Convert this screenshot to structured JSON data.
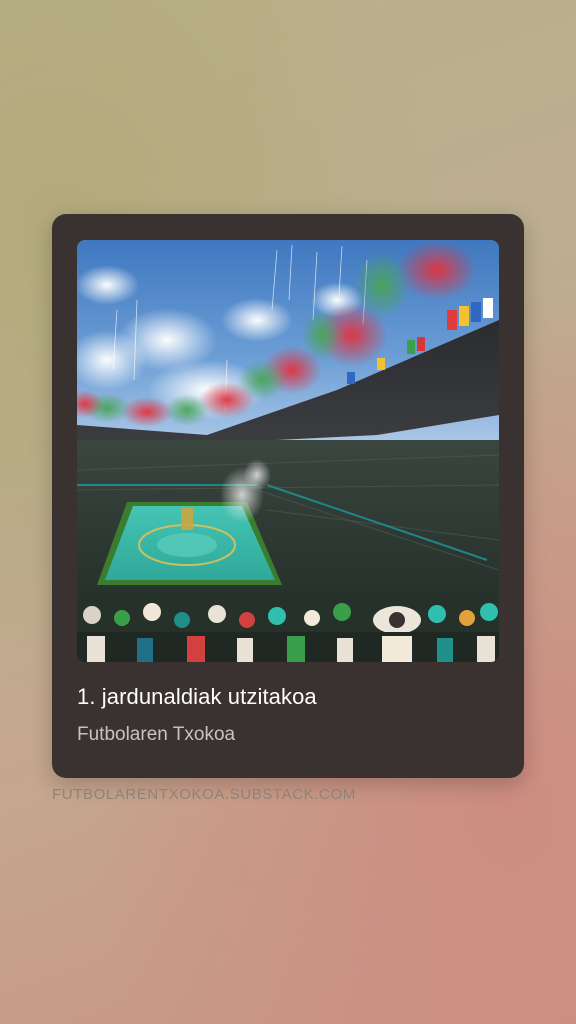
{
  "card": {
    "title": "1. jardunaldiak utzitakoa",
    "subtitle": "Futbolaren Txokoa",
    "image": {
      "subject": "stadium-ceremony-photo",
      "colors": {
        "sky": "#4f86c8",
        "cloud": "#f2f4f6",
        "smoke_green": "#3f9a53",
        "smoke_red": "#d9323b",
        "pitch": "#38b8a8",
        "crowd": "#2d3b35"
      }
    }
  },
  "footer": {
    "source_url": "FUTBOLARENTXOKOA.SUBSTACK.COM"
  },
  "colors": {
    "card_bg": "#3a3230",
    "title": "#ffffff",
    "subtitle": "#c9c3bf",
    "url": "#8e8379"
  }
}
